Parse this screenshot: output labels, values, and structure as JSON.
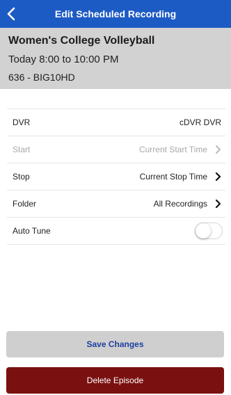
{
  "header": {
    "title": "Edit Scheduled Recording",
    "back_icon": "chevron-left-icon"
  },
  "program": {
    "title": "Women's College Volleyball",
    "time": "Today 8:00 to 10:00 PM",
    "channel": "636 - BIG10HD"
  },
  "settings": {
    "dvr": {
      "label": "DVR",
      "value": "cDVR DVR"
    },
    "start": {
      "label": "Start",
      "value": "Current Start Time",
      "enabled": false
    },
    "stop": {
      "label": "Stop",
      "value": "Current Stop Time"
    },
    "folder": {
      "label": "Folder",
      "value": "All Recordings"
    },
    "auto_tune": {
      "label": "Auto Tune",
      "on": false
    }
  },
  "actions": {
    "save_label": "Save Changes",
    "delete_label": "Delete Episode"
  },
  "colors": {
    "header_bg": "#1d5bc4",
    "program_bg": "#d2d2d2",
    "save_bg": "#cfcfcf",
    "save_text": "#1d3fa0",
    "delete_bg": "#7a1010"
  }
}
